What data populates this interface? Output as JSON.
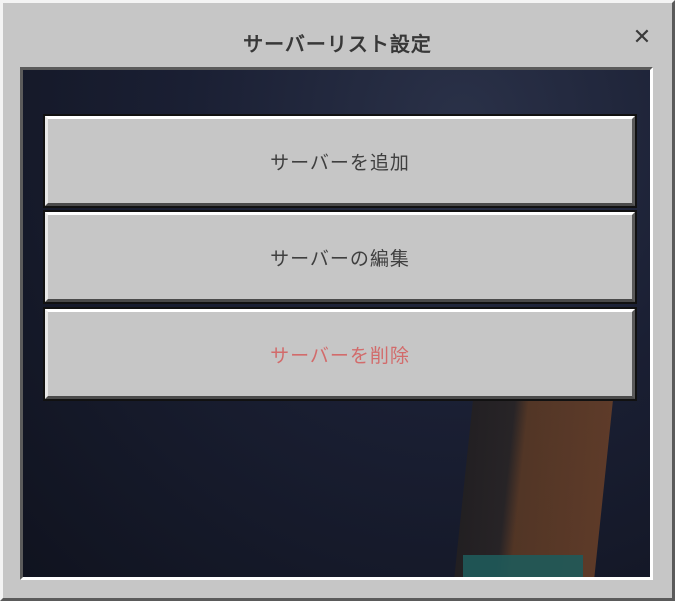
{
  "dialog": {
    "title": "サーバーリスト設定",
    "close_icon": "close-icon"
  },
  "menu": {
    "add_label": "サーバーを追加",
    "edit_label": "サーバーの編集",
    "delete_label": "サーバーを削除"
  },
  "colors": {
    "panel": "#c6c6c6",
    "text": "#3f3f3f",
    "danger": "#d26b6b",
    "background": "#1c2238"
  }
}
